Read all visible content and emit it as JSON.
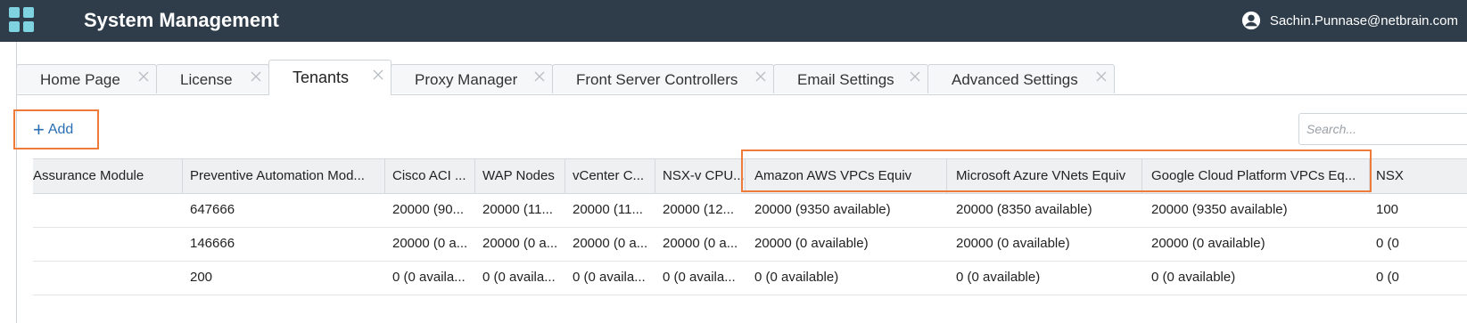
{
  "header": {
    "title": "System Management",
    "user": "Sachin.Punnase@netbrain.com",
    "app_icon": "grid-apps-icon",
    "user_icon": "user-circle-icon",
    "bg_color": "#2f3d4a"
  },
  "tabs": [
    {
      "label": "Home Page",
      "active": false
    },
    {
      "label": "License",
      "active": false
    },
    {
      "label": "Tenants",
      "active": true
    },
    {
      "label": "Proxy Manager",
      "active": false
    },
    {
      "label": "Front Server Controllers",
      "active": false
    },
    {
      "label": "Email Settings",
      "active": false
    },
    {
      "label": "Advanced Settings",
      "active": false
    }
  ],
  "toolbar": {
    "add_label": "Add",
    "search_placeholder": "Search..."
  },
  "table": {
    "columns": [
      "Assurance Module",
      "Preventive Automation Mod...",
      "Cisco ACI ...",
      "WAP Nodes",
      "vCenter C...",
      "NSX-v CPU...",
      "Amazon AWS VPCs Equiv",
      "Microsoft Azure VNets Equiv",
      "Google Cloud Platform VPCs Eq...",
      "NSX"
    ],
    "rows": [
      [
        "",
        "647666",
        "20000 (90...",
        "20000 (11...",
        "20000 (11...",
        "20000 (12...",
        "20000 (9350 available)",
        "20000 (8350 available)",
        "20000 (9350 available)",
        "100"
      ],
      [
        "",
        "146666",
        "20000 (0 a...",
        "20000 (0 a...",
        "20000 (0 a...",
        "20000 (0 a...",
        "20000 (0 available)",
        "20000 (0 available)",
        "20000 (0 available)",
        "0 (0"
      ],
      [
        "",
        "200",
        "0 (0 availa...",
        "0 (0 availa...",
        "0 (0 availa...",
        "0 (0 availa...",
        "0 (0 available)",
        "0 (0 available)",
        "0 (0 available)",
        "0 (0"
      ]
    ]
  },
  "colors": {
    "accent": "#2a6fb3",
    "highlight": "#ee7b3a",
    "icon_cyan": "#7fd3e0"
  }
}
